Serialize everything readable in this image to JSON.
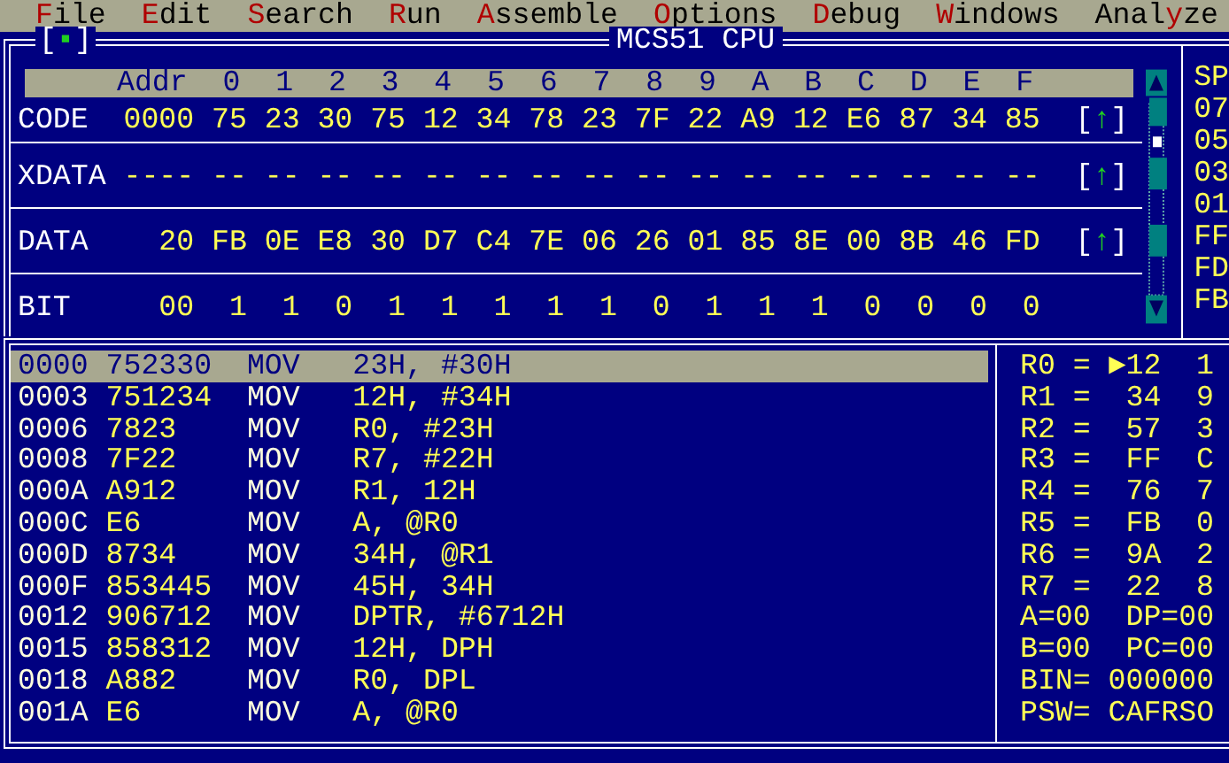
{
  "menu": [
    {
      "key": "F",
      "rest": "ile"
    },
    {
      "key": "E",
      "rest": "dit"
    },
    {
      "key": "S",
      "rest": "earch"
    },
    {
      "key": "R",
      "rest": "un"
    },
    {
      "key": "A",
      "rest": "ssemble"
    },
    {
      "key": "O",
      "rest": "ptions"
    },
    {
      "key": "D",
      "rest": "ebug"
    },
    {
      "key": "W",
      "rest": "indows"
    },
    {
      "pre": "Anal",
      "key": "y",
      "rest": "ze"
    }
  ],
  "cpu_window": {
    "close_box": {
      "open": "[",
      "mark": "▪",
      "close": "]"
    },
    "title": "MCS51 CPU",
    "header": [
      "Addr",
      "0",
      "1",
      "2",
      "3",
      "4",
      "5",
      "6",
      "7",
      "8",
      "9",
      "A",
      "B",
      "C",
      "D",
      "E",
      "F"
    ],
    "memory": [
      {
        "name": "CODE",
        "addr": "0000",
        "values": [
          "75",
          "23",
          "30",
          "75",
          "12",
          "34",
          "78",
          "23",
          "7F",
          "22",
          "A9",
          "12",
          "E6",
          "87",
          "34",
          "85"
        ],
        "button": {
          "open": "[",
          "arrow": "↑",
          "close": "]"
        }
      },
      {
        "name": "XDATA",
        "addr": "----",
        "values": [
          "--",
          "--",
          "--",
          "--",
          "--",
          "--",
          "--",
          "--",
          "--",
          "--",
          "--",
          "--",
          "--",
          "--",
          "--",
          "--"
        ],
        "button": {
          "open": "[",
          "arrow": "↑",
          "close": "]"
        }
      },
      {
        "name": "DATA",
        "values": [
          "20",
          "FB",
          "0E",
          "E8",
          "30",
          "D7",
          "C4",
          "7E",
          "06",
          "26",
          "01",
          "85",
          "8E",
          "00",
          "8B",
          "46",
          "FD"
        ],
        "button": {
          "open": "[",
          "arrow": "↑",
          "close": "]"
        }
      },
      {
        "name": "BIT",
        "addr": "00",
        "values": [
          "1",
          "1",
          "0",
          "1",
          "1",
          "1",
          "1",
          "1",
          "0",
          "1",
          "1",
          "1",
          "0",
          "0",
          "0",
          "0"
        ]
      }
    ],
    "stack": [
      "SP",
      "07",
      "05",
      "03",
      "01",
      "FF",
      "FD",
      "FB"
    ]
  },
  "disassembly": [
    {
      "addr": "0000",
      "bytes": "752330",
      "mnemonic": "MOV",
      "operands": "23H, #30H",
      "selected": true
    },
    {
      "addr": "0003",
      "bytes": "751234",
      "mnemonic": "MOV",
      "operands": "12H, #34H",
      "selected": false
    },
    {
      "addr": "0006",
      "bytes": "7823",
      "mnemonic": "MOV",
      "operands": "R0, #23H",
      "selected": false
    },
    {
      "addr": "0008",
      "bytes": "7F22",
      "mnemonic": "MOV",
      "operands": "R7, #22H",
      "selected": false
    },
    {
      "addr": "000A",
      "bytes": "A912",
      "mnemonic": "MOV",
      "operands": "R1, 12H",
      "selected": false
    },
    {
      "addr": "000C",
      "bytes": "E6",
      "mnemonic": "MOV",
      "operands": "A, @R0",
      "selected": false
    },
    {
      "addr": "000D",
      "bytes": "8734",
      "mnemonic": "MOV",
      "operands": "34H, @R1",
      "selected": false
    },
    {
      "addr": "000F",
      "bytes": "853445",
      "mnemonic": "MOV",
      "operands": "45H, 34H",
      "selected": false
    },
    {
      "addr": "0012",
      "bytes": "906712",
      "mnemonic": "MOV",
      "operands": "DPTR, #6712H",
      "selected": false
    },
    {
      "addr": "0015",
      "bytes": "858312",
      "mnemonic": "MOV",
      "operands": "12H, DPH",
      "selected": false
    },
    {
      "addr": "0018",
      "bytes": "A882",
      "mnemonic": "MOV",
      "operands": "R0, DPL",
      "selected": false
    },
    {
      "addr": "001A",
      "bytes": "E6",
      "mnemonic": "MOV",
      "operands": "A, @R0",
      "selected": false
    }
  ],
  "registers": [
    {
      "name": "R0 =",
      "marker": "►",
      "value": "12",
      "column_2": "1"
    },
    {
      "name": "R1 =",
      "value": "34",
      "column_2": "9"
    },
    {
      "name": "R2 =",
      "value": "57",
      "column_2": "3"
    },
    {
      "name": "R3 =",
      "value": "FF",
      "column_2": "C"
    },
    {
      "name": "R4 =",
      "value": "76",
      "column_2": "7"
    },
    {
      "name": "R5 =",
      "value": "FB",
      "column_2": "0"
    },
    {
      "name": "R6 =",
      "value": "9A",
      "column_2": "2"
    },
    {
      "name": "R7 =",
      "value": "22",
      "column_2": "8"
    }
  ],
  "status_lines": [
    "A=00  DP=00",
    "B=00  PC=00",
    "BIN= 000000",
    "PSW= CAFRSO"
  ]
}
